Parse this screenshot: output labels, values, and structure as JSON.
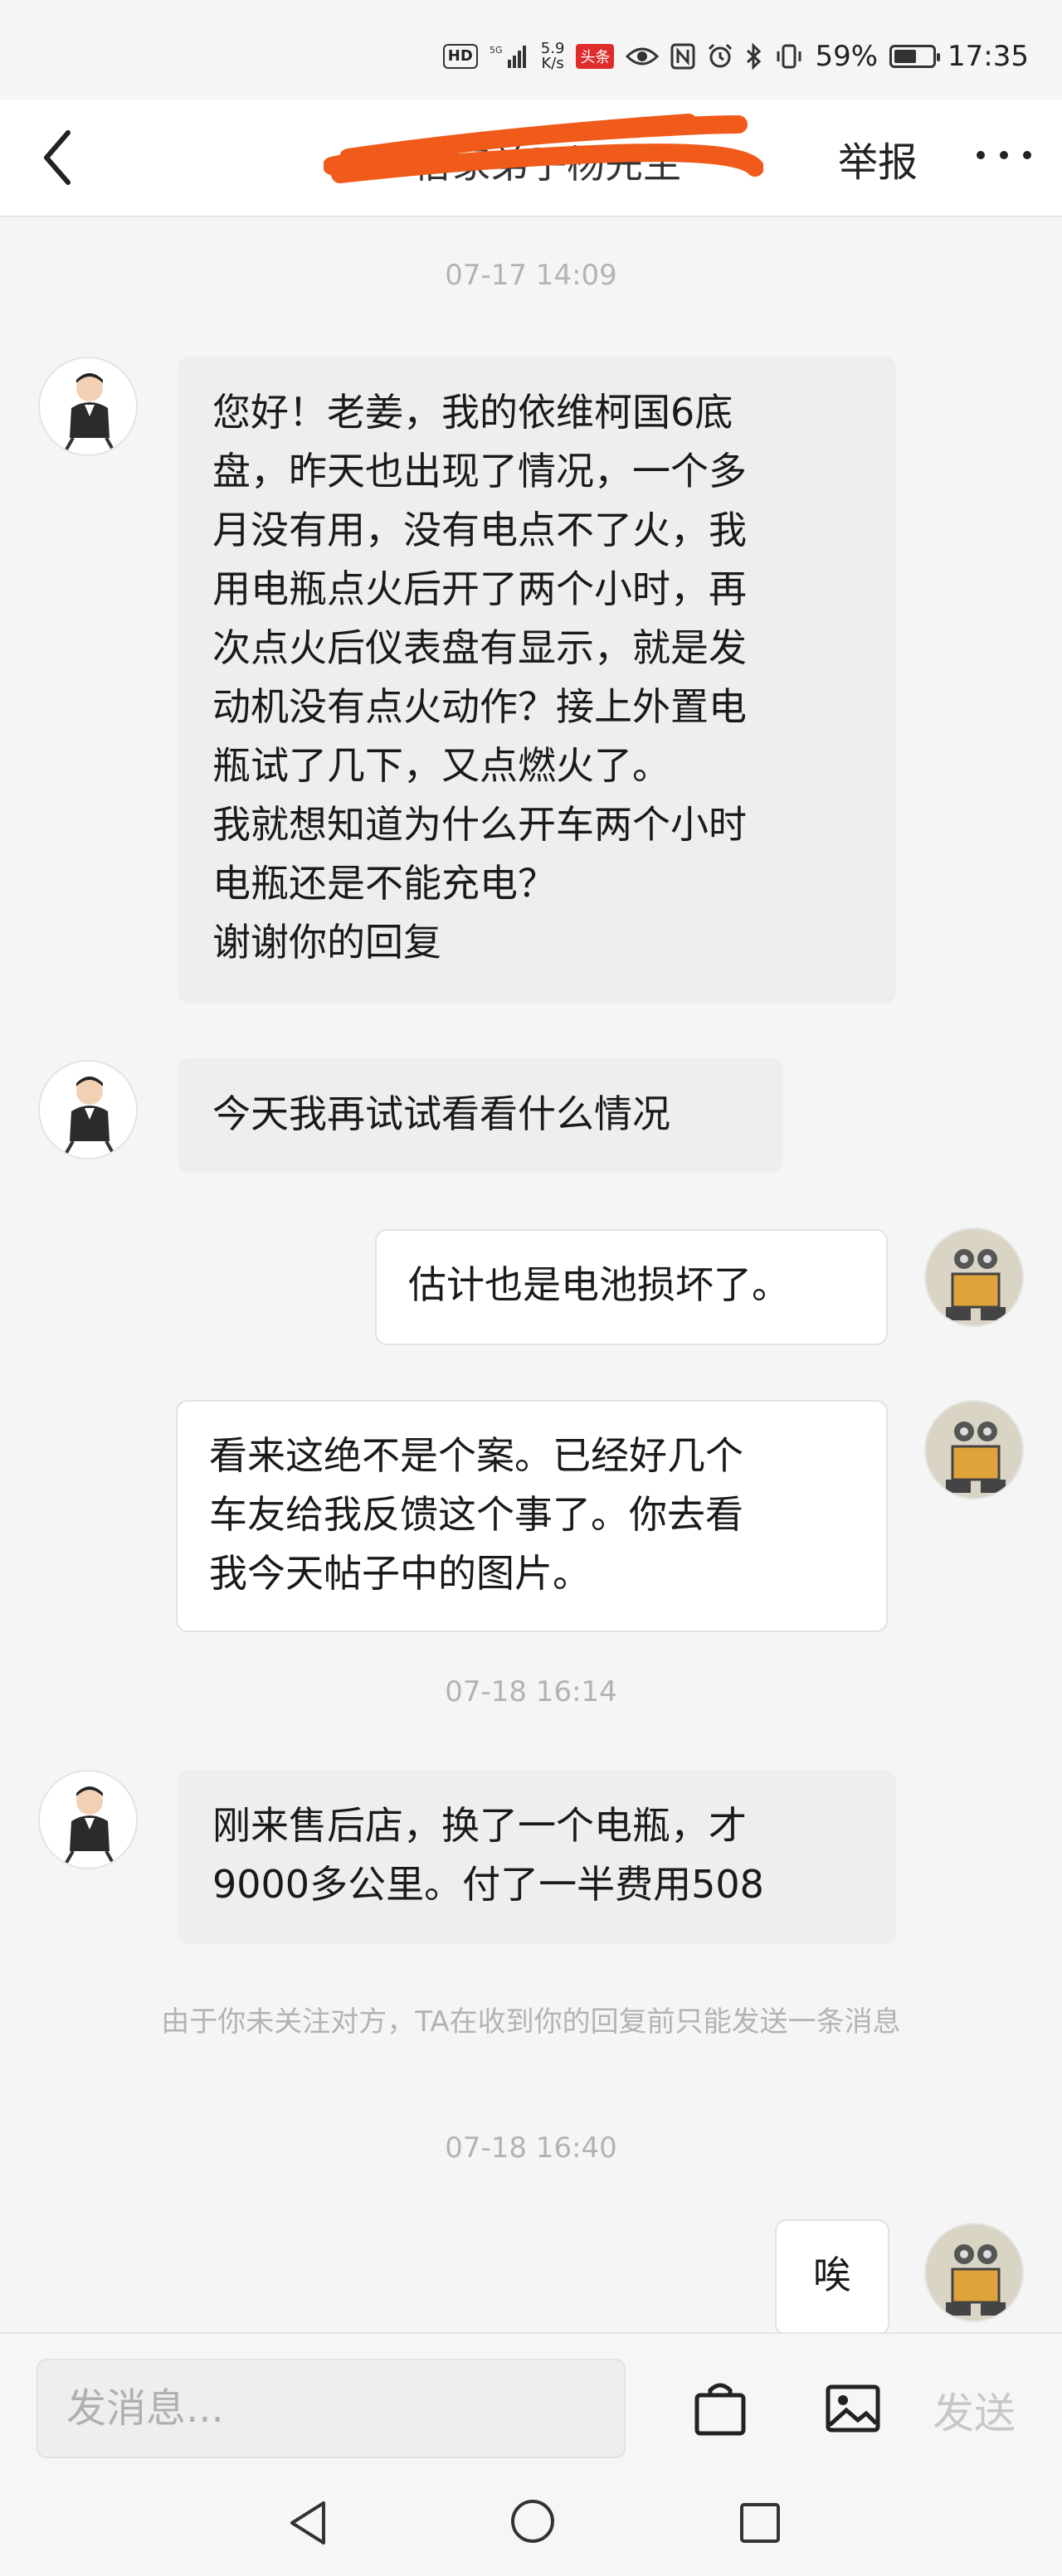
{
  "status_bar": {
    "hd": "HD",
    "net_speed_value": "5.9",
    "net_speed_unit": "K/s",
    "app_badge": "头条",
    "battery_pct": "59%",
    "battery_level": 0.59,
    "time": "17:35"
  },
  "header": {
    "title": "俗家弟子杨先生",
    "report_label": "举报"
  },
  "messages": [
    {
      "type": "timestamp",
      "text": "07-17 14:09"
    },
    {
      "type": "incoming",
      "text": "您好！老姜，我的依维柯国6底\n盘，昨天也出现了情况，一个多\n月没有用，没有电点不了火，我\n用电瓶点火后开了两个小时，再\n次点火后仪表盘有显示，就是发\n动机没有点火动作？接上外置电\n瓶试了几下，又点燃火了。\n我就想知道为什么开车两个小时\n电瓶还是不能充电？\n谢谢你的回复"
    },
    {
      "type": "incoming",
      "text": "今天我再试试看看什么情况"
    },
    {
      "type": "outgoing",
      "text": "估计也是电池损坏了。"
    },
    {
      "type": "outgoing",
      "text": "看来这绝不是个案。已经好几个\n车友给我反馈这个事了。你去看\n我今天帖子中的图片。"
    },
    {
      "type": "timestamp",
      "text": "07-18 16:14"
    },
    {
      "type": "incoming",
      "text": "刚来售后店，换了一个电瓶，才\n9000多公里。付了一半费用508"
    },
    {
      "type": "notice",
      "text": "由于你未关注对方，TA在收到你的回复前只能发送一条消息"
    },
    {
      "type": "timestamp",
      "text": "07-18 16:40"
    },
    {
      "type": "outgoing",
      "text": "唉"
    }
  ],
  "input_bar": {
    "placeholder": "发消息...",
    "send_label": "发送"
  },
  "icons": {
    "back": "back-arrow-icon",
    "more": "more-dots-icon",
    "shop": "shopping-bag-icon",
    "image": "image-icon",
    "sys_back": "triangle-back-icon",
    "sys_home": "circle-home-icon",
    "sys_recent": "square-recent-icon"
  },
  "colors": {
    "background": "#f5f5f6",
    "incoming_bubble": "#eeeef0",
    "outgoing_bubble": "#ffffff",
    "muted_text": "#b3b3b3",
    "redaction": "#f05a1a"
  }
}
